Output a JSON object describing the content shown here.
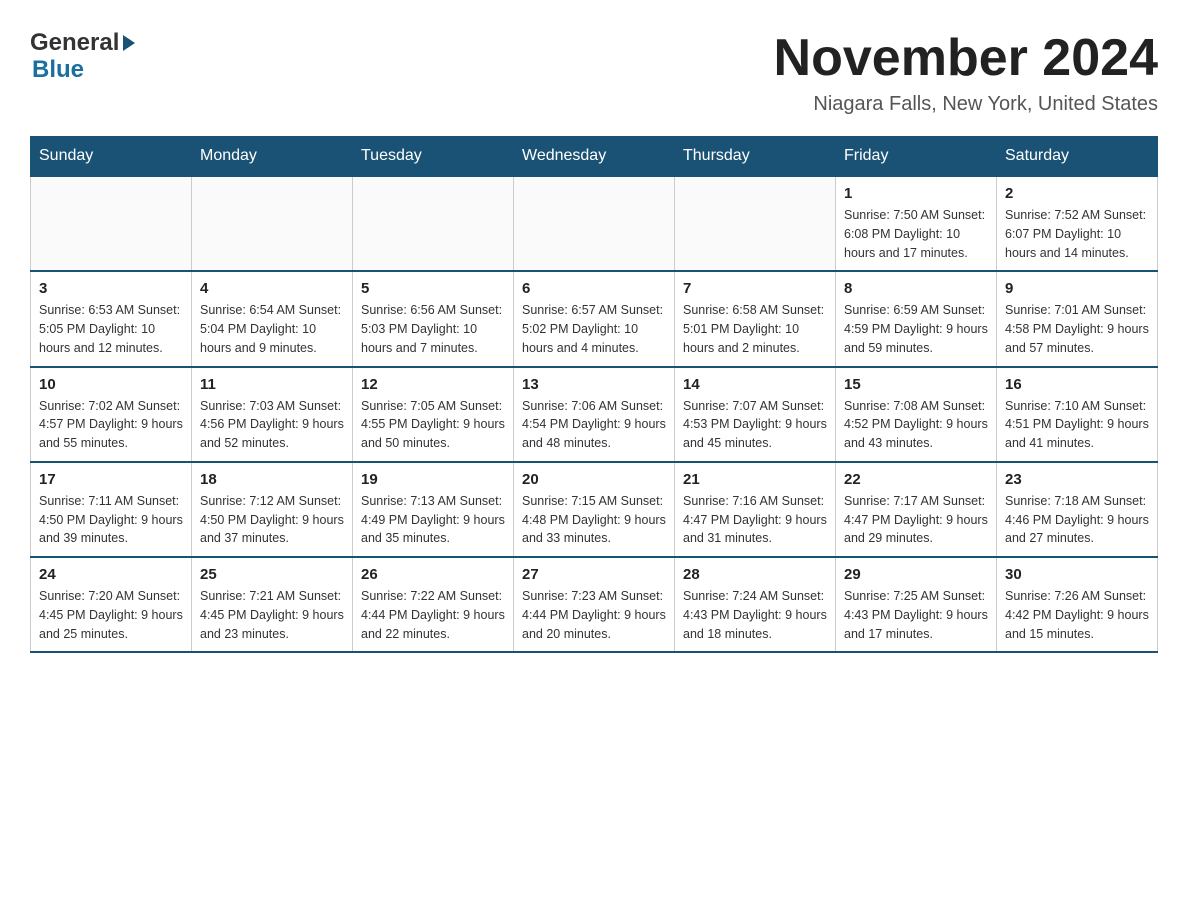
{
  "header": {
    "logo_general": "General",
    "logo_blue": "Blue",
    "month_title": "November 2024",
    "location": "Niagara Falls, New York, United States"
  },
  "weekdays": [
    "Sunday",
    "Monday",
    "Tuesday",
    "Wednesday",
    "Thursday",
    "Friday",
    "Saturday"
  ],
  "weeks": [
    {
      "days": [
        {
          "number": "",
          "info": ""
        },
        {
          "number": "",
          "info": ""
        },
        {
          "number": "",
          "info": ""
        },
        {
          "number": "",
          "info": ""
        },
        {
          "number": "",
          "info": ""
        },
        {
          "number": "1",
          "info": "Sunrise: 7:50 AM\nSunset: 6:08 PM\nDaylight: 10 hours\nand 17 minutes."
        },
        {
          "number": "2",
          "info": "Sunrise: 7:52 AM\nSunset: 6:07 PM\nDaylight: 10 hours\nand 14 minutes."
        }
      ]
    },
    {
      "days": [
        {
          "number": "3",
          "info": "Sunrise: 6:53 AM\nSunset: 5:05 PM\nDaylight: 10 hours\nand 12 minutes."
        },
        {
          "number": "4",
          "info": "Sunrise: 6:54 AM\nSunset: 5:04 PM\nDaylight: 10 hours\nand 9 minutes."
        },
        {
          "number": "5",
          "info": "Sunrise: 6:56 AM\nSunset: 5:03 PM\nDaylight: 10 hours\nand 7 minutes."
        },
        {
          "number": "6",
          "info": "Sunrise: 6:57 AM\nSunset: 5:02 PM\nDaylight: 10 hours\nand 4 minutes."
        },
        {
          "number": "7",
          "info": "Sunrise: 6:58 AM\nSunset: 5:01 PM\nDaylight: 10 hours\nand 2 minutes."
        },
        {
          "number": "8",
          "info": "Sunrise: 6:59 AM\nSunset: 4:59 PM\nDaylight: 9 hours\nand 59 minutes."
        },
        {
          "number": "9",
          "info": "Sunrise: 7:01 AM\nSunset: 4:58 PM\nDaylight: 9 hours\nand 57 minutes."
        }
      ]
    },
    {
      "days": [
        {
          "number": "10",
          "info": "Sunrise: 7:02 AM\nSunset: 4:57 PM\nDaylight: 9 hours\nand 55 minutes."
        },
        {
          "number": "11",
          "info": "Sunrise: 7:03 AM\nSunset: 4:56 PM\nDaylight: 9 hours\nand 52 minutes."
        },
        {
          "number": "12",
          "info": "Sunrise: 7:05 AM\nSunset: 4:55 PM\nDaylight: 9 hours\nand 50 minutes."
        },
        {
          "number": "13",
          "info": "Sunrise: 7:06 AM\nSunset: 4:54 PM\nDaylight: 9 hours\nand 48 minutes."
        },
        {
          "number": "14",
          "info": "Sunrise: 7:07 AM\nSunset: 4:53 PM\nDaylight: 9 hours\nand 45 minutes."
        },
        {
          "number": "15",
          "info": "Sunrise: 7:08 AM\nSunset: 4:52 PM\nDaylight: 9 hours\nand 43 minutes."
        },
        {
          "number": "16",
          "info": "Sunrise: 7:10 AM\nSunset: 4:51 PM\nDaylight: 9 hours\nand 41 minutes."
        }
      ]
    },
    {
      "days": [
        {
          "number": "17",
          "info": "Sunrise: 7:11 AM\nSunset: 4:50 PM\nDaylight: 9 hours\nand 39 minutes."
        },
        {
          "number": "18",
          "info": "Sunrise: 7:12 AM\nSunset: 4:50 PM\nDaylight: 9 hours\nand 37 minutes."
        },
        {
          "number": "19",
          "info": "Sunrise: 7:13 AM\nSunset: 4:49 PM\nDaylight: 9 hours\nand 35 minutes."
        },
        {
          "number": "20",
          "info": "Sunrise: 7:15 AM\nSunset: 4:48 PM\nDaylight: 9 hours\nand 33 minutes."
        },
        {
          "number": "21",
          "info": "Sunrise: 7:16 AM\nSunset: 4:47 PM\nDaylight: 9 hours\nand 31 minutes."
        },
        {
          "number": "22",
          "info": "Sunrise: 7:17 AM\nSunset: 4:47 PM\nDaylight: 9 hours\nand 29 minutes."
        },
        {
          "number": "23",
          "info": "Sunrise: 7:18 AM\nSunset: 4:46 PM\nDaylight: 9 hours\nand 27 minutes."
        }
      ]
    },
    {
      "days": [
        {
          "number": "24",
          "info": "Sunrise: 7:20 AM\nSunset: 4:45 PM\nDaylight: 9 hours\nand 25 minutes."
        },
        {
          "number": "25",
          "info": "Sunrise: 7:21 AM\nSunset: 4:45 PM\nDaylight: 9 hours\nand 23 minutes."
        },
        {
          "number": "26",
          "info": "Sunrise: 7:22 AM\nSunset: 4:44 PM\nDaylight: 9 hours\nand 22 minutes."
        },
        {
          "number": "27",
          "info": "Sunrise: 7:23 AM\nSunset: 4:44 PM\nDaylight: 9 hours\nand 20 minutes."
        },
        {
          "number": "28",
          "info": "Sunrise: 7:24 AM\nSunset: 4:43 PM\nDaylight: 9 hours\nand 18 minutes."
        },
        {
          "number": "29",
          "info": "Sunrise: 7:25 AM\nSunset: 4:43 PM\nDaylight: 9 hours\nand 17 minutes."
        },
        {
          "number": "30",
          "info": "Sunrise: 7:26 AM\nSunset: 4:42 PM\nDaylight: 9 hours\nand 15 minutes."
        }
      ]
    }
  ]
}
